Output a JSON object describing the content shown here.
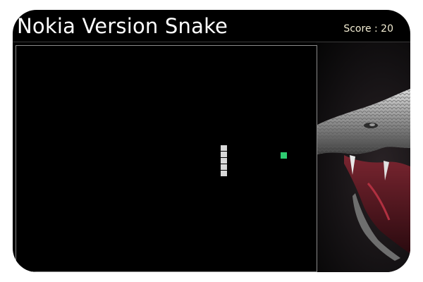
{
  "header": {
    "title": "Nokia Version Snake",
    "score_text": "Score : 20"
  },
  "game": {
    "snake_segments": 5,
    "snake_color": "#d8d8d8",
    "food_color": "#2ecc71",
    "board_background": "#000000",
    "board_border": "#8a8a8a"
  },
  "backdrop": {
    "image_icon": "snake-head-image"
  },
  "colors": {
    "page_background": "#000000",
    "title_text": "#ffffff",
    "score_text": "#f2ecd2"
  }
}
